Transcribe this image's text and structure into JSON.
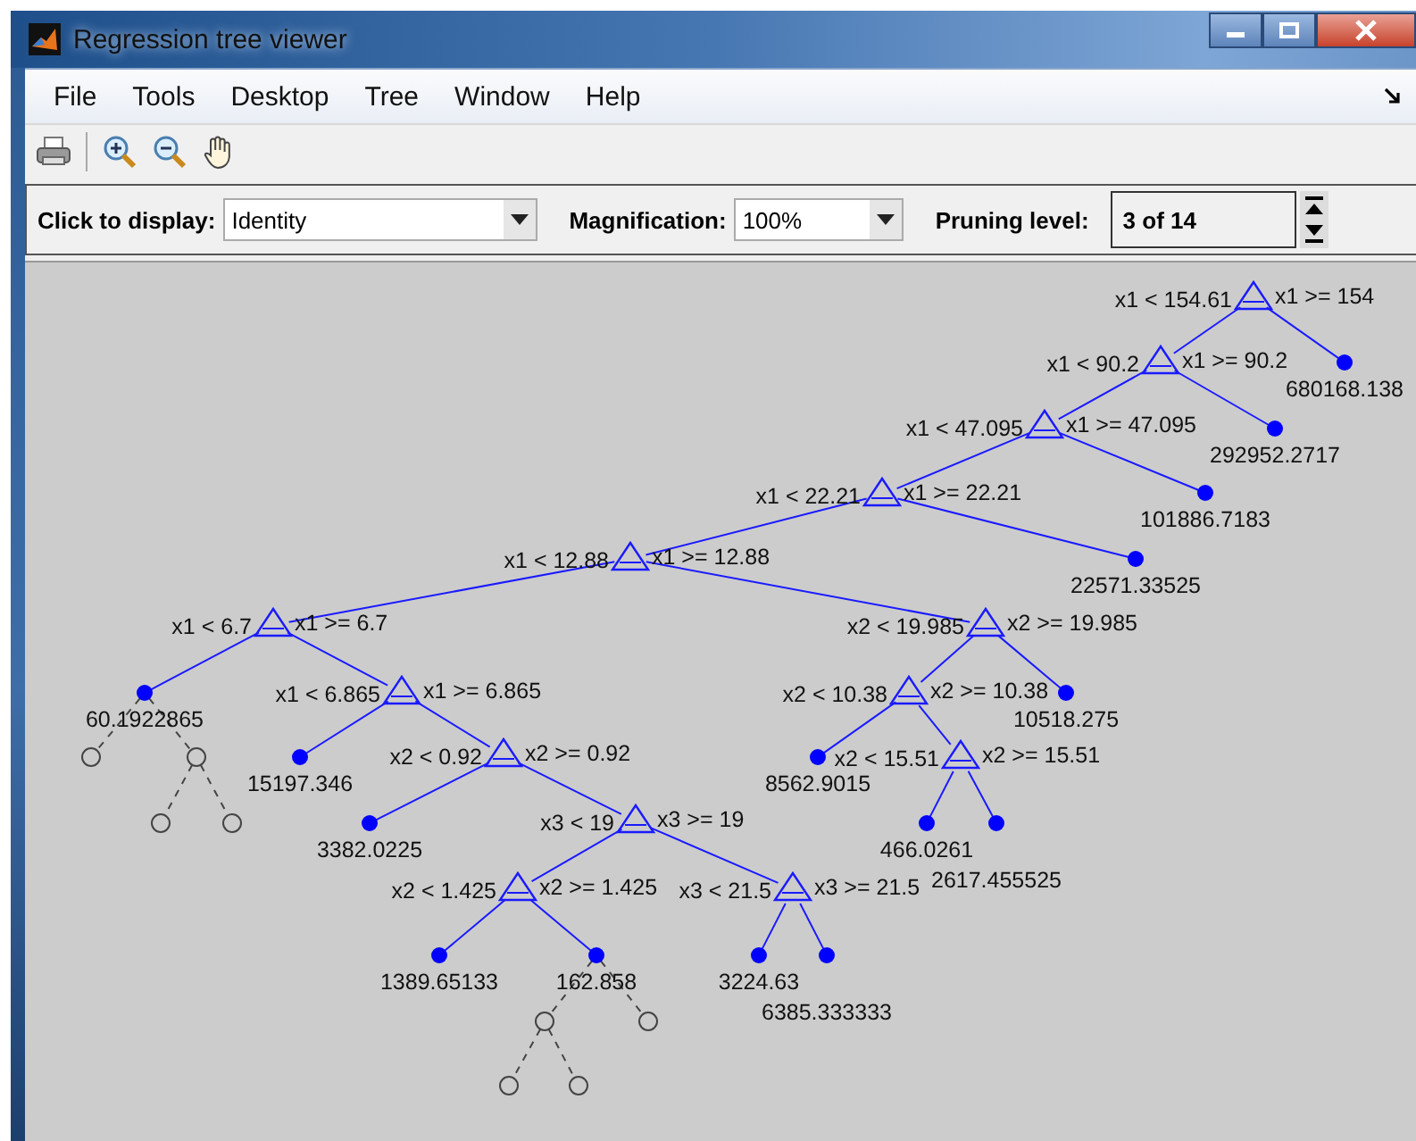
{
  "window": {
    "title": "Regression tree viewer"
  },
  "menu": [
    "File",
    "Tools",
    "Desktop",
    "Tree",
    "Window",
    "Help"
  ],
  "controls": {
    "display_label": "Click to display:",
    "display_value": "Identity",
    "magnification_label": "Magnification:",
    "magnification_value": "100%",
    "pruning_label": "Pruning level:",
    "pruning_value": "3 of 14"
  },
  "tree": {
    "kind": "branch",
    "left_label": "x1 < 154.61",
    "right_label": "x1 >= 154",
    "children": [
      {
        "kind": "branch",
        "left_label": "x1 < 90.2",
        "right_label": "x1 >= 90.2",
        "children": [
          {
            "kind": "branch",
            "left_label": "x1 < 47.095",
            "right_label": "x1 >= 47.095",
            "children": [
              {
                "kind": "branch",
                "left_label": "x1 < 22.21",
                "right_label": "x1 >= 22.21",
                "children": [
                  {
                    "kind": "branch",
                    "left_label": "x1 < 12.88",
                    "right_label": "x1 >= 12.88",
                    "children": [
                      {
                        "kind": "branch",
                        "left_label": "x1 < 6.7",
                        "right_label": "x1 >= 6.7",
                        "children": [
                          {
                            "kind": "leaf",
                            "value": "60.1922865",
                            "children": [
                              {
                                "kind": "pruned"
                              },
                              {
                                "kind": "pruned",
                                "children": [
                                  {
                                    "kind": "pruned"
                                  },
                                  {
                                    "kind": "pruned"
                                  }
                                ]
                              }
                            ]
                          },
                          {
                            "kind": "branch",
                            "left_label": "x1 < 6.865",
                            "right_label": "x1 >= 6.865",
                            "children": [
                              {
                                "kind": "leaf",
                                "value": "15197.346"
                              },
                              {
                                "kind": "branch",
                                "left_label": "x2 < 0.92",
                                "right_label": "x2 >= 0.92",
                                "children": [
                                  {
                                    "kind": "leaf",
                                    "value": "3382.0225"
                                  },
                                  {
                                    "kind": "branch",
                                    "left_label": "x3 < 19",
                                    "right_label": "x3 >= 19",
                                    "children": [
                                      {
                                        "kind": "branch",
                                        "left_label": "x2 < 1.425",
                                        "right_label": "x2 >= 1.425",
                                        "children": [
                                          {
                                            "kind": "leaf",
                                            "value": "1389.65133"
                                          },
                                          {
                                            "kind": "leaf",
                                            "value": "162.858",
                                            "children": [
                                              {
                                                "kind": "pruned",
                                                "children": [
                                                  {
                                                    "kind": "pruned"
                                                  },
                                                  {
                                                    "kind": "pruned"
                                                  }
                                                ]
                                              },
                                              {
                                                "kind": "pruned"
                                              }
                                            ]
                                          }
                                        ]
                                      },
                                      {
                                        "kind": "branch",
                                        "left_label": "x3 < 21.5",
                                        "right_label": "x3 >= 21.5",
                                        "children": [
                                          {
                                            "kind": "leaf",
                                            "value": "3224.63"
                                          },
                                          {
                                            "kind": "leaf",
                                            "value": "6385.333333"
                                          }
                                        ]
                                      }
                                    ]
                                  }
                                ]
                              }
                            ]
                          }
                        ]
                      },
                      {
                        "kind": "branch",
                        "left_label": "x2 < 19.985",
                        "right_label": "x2 >= 19.985",
                        "children": [
                          {
                            "kind": "branch",
                            "left_label": "x2 < 10.38",
                            "right_label": "x2 >= 10.38",
                            "children": [
                              {
                                "kind": "leaf",
                                "value": "8562.9015"
                              },
                              {
                                "kind": "branch",
                                "left_label": "x2 < 15.51",
                                "right_label": "x2 >= 15.51",
                                "children": [
                                  {
                                    "kind": "leaf",
                                    "value": "466.0261"
                                  },
                                  {
                                    "kind": "leaf",
                                    "value": "2617.455525"
                                  }
                                ]
                              }
                            ]
                          },
                          {
                            "kind": "leaf",
                            "value": "10518.275"
                          }
                        ]
                      }
                    ]
                  },
                  {
                    "kind": "leaf",
                    "value": "22571.33525"
                  }
                ]
              },
              {
                "kind": "leaf",
                "value": "101886.7183"
              }
            ]
          },
          {
            "kind": "leaf",
            "value": "292952.2717"
          }
        ]
      },
      {
        "kind": "leaf",
        "value": "680168.138"
      }
    ]
  }
}
